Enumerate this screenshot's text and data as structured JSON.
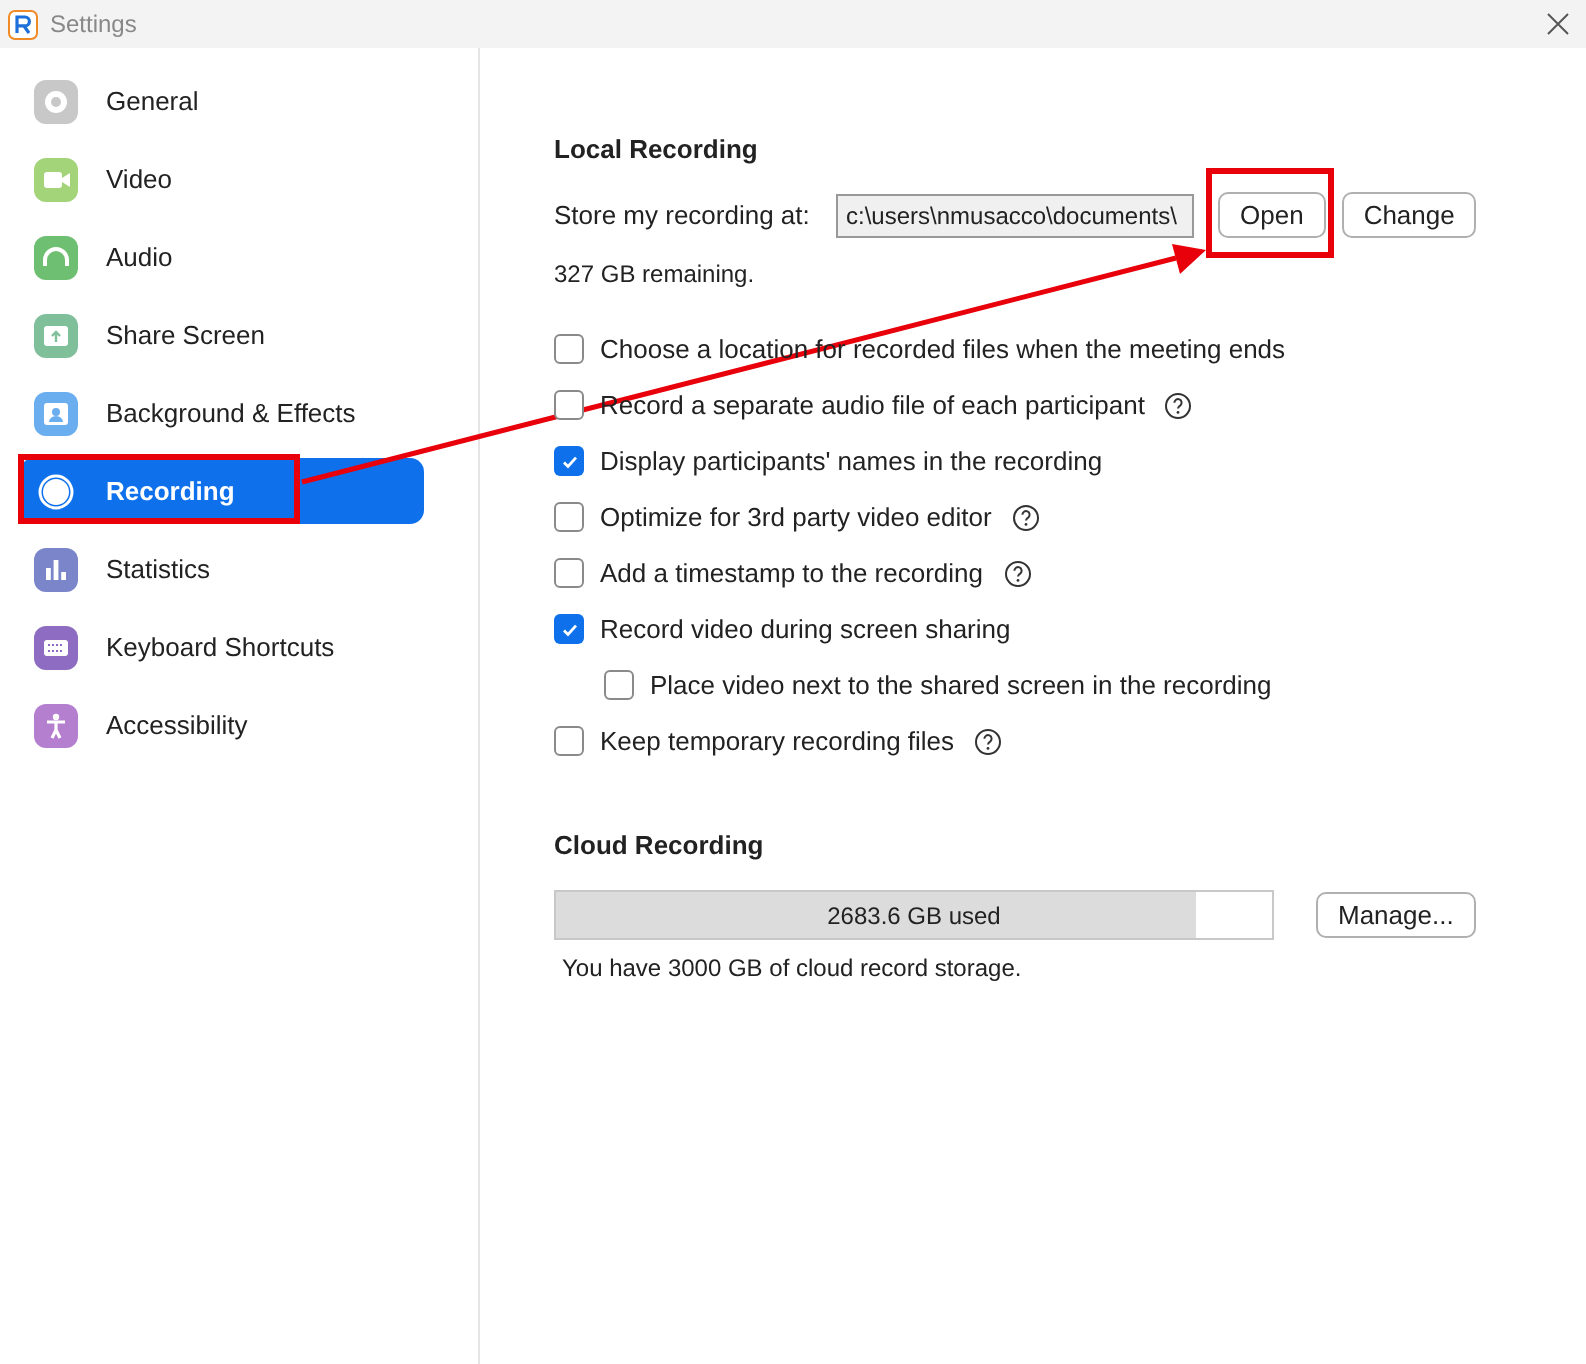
{
  "window": {
    "title": "Settings"
  },
  "sidebar": {
    "items": [
      {
        "label": "General",
        "selected": false,
        "color": "#c8c8c8",
        "annotated": false
      },
      {
        "label": "Video",
        "selected": false,
        "color": "#a3d47a",
        "annotated": false
      },
      {
        "label": "Audio",
        "selected": false,
        "color": "#6fbf73",
        "annotated": false
      },
      {
        "label": "Share Screen",
        "selected": false,
        "color": "#7fc09a",
        "annotated": false
      },
      {
        "label": "Background & Effects",
        "selected": false,
        "color": "#6aaef0",
        "annotated": false
      },
      {
        "label": "Recording",
        "selected": true,
        "color": "#ffffff",
        "annotated": true
      },
      {
        "label": "Statistics",
        "selected": false,
        "color": "#7a86c9",
        "annotated": false
      },
      {
        "label": "Keyboard Shortcuts",
        "selected": false,
        "color": "#8e6cc2",
        "annotated": false
      },
      {
        "label": "Accessibility",
        "selected": false,
        "color": "#b57fcf",
        "annotated": false
      }
    ]
  },
  "local": {
    "title": "Local Recording",
    "store_label": "Store my recording at:",
    "path": "c:\\users\\nmusacco\\documents\\",
    "buttons": [
      {
        "label": "Open",
        "annotated": true
      },
      {
        "label": "Change",
        "annotated": false
      }
    ],
    "remaining": "327 GB remaining.",
    "options": [
      {
        "label": "Choose a location for recorded files when the meeting ends",
        "checked": false,
        "help": false
      },
      {
        "label": "Record a separate audio file of each participant",
        "checked": false,
        "help": true
      },
      {
        "label": "Display participants' names in the recording",
        "checked": true,
        "help": false
      },
      {
        "label": "Optimize for 3rd party video editor",
        "checked": false,
        "help": true
      },
      {
        "label": "Add a timestamp to the recording",
        "checked": false,
        "help": true
      },
      {
        "label": "Record video during screen sharing",
        "checked": true,
        "help": false,
        "children": [
          {
            "label": "Place video next to the shared screen in the recording",
            "checked": false,
            "help": false
          }
        ]
      },
      {
        "label": "Keep temporary recording files",
        "checked": false,
        "help": true
      }
    ]
  },
  "cloud": {
    "title": "Cloud Recording",
    "used": "2683.6 GB used",
    "level": 0.894,
    "manage": "Manage...",
    "note": "You have 3000 GB of cloud record storage."
  }
}
